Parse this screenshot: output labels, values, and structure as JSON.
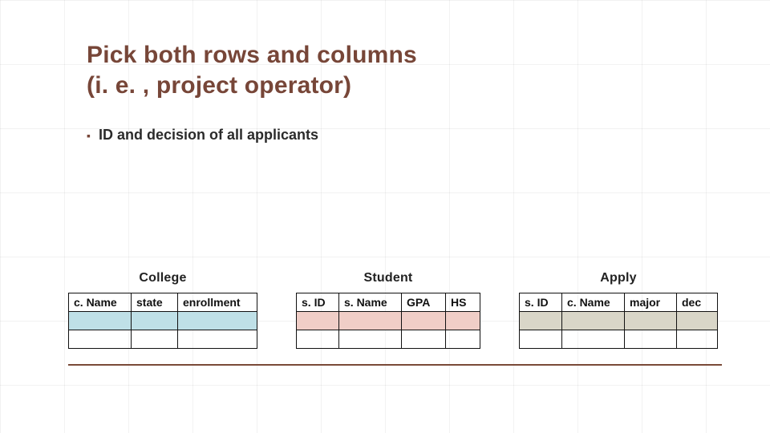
{
  "title_line1": "Pick both rows and columns",
  "title_line2": "(i. e. , project operator)",
  "bullet_marker": "▪",
  "bullet_text": "ID and decision of all applicants",
  "tables": {
    "college": {
      "caption": "College",
      "headers": [
        "c. Name",
        "state",
        "enrollment"
      ]
    },
    "student": {
      "caption": "Student",
      "headers": [
        "s. ID",
        "s. Name",
        "GPA",
        "HS"
      ]
    },
    "apply": {
      "caption": "Apply",
      "headers": [
        "s. ID",
        "c. Name",
        "major",
        "dec"
      ]
    }
  }
}
